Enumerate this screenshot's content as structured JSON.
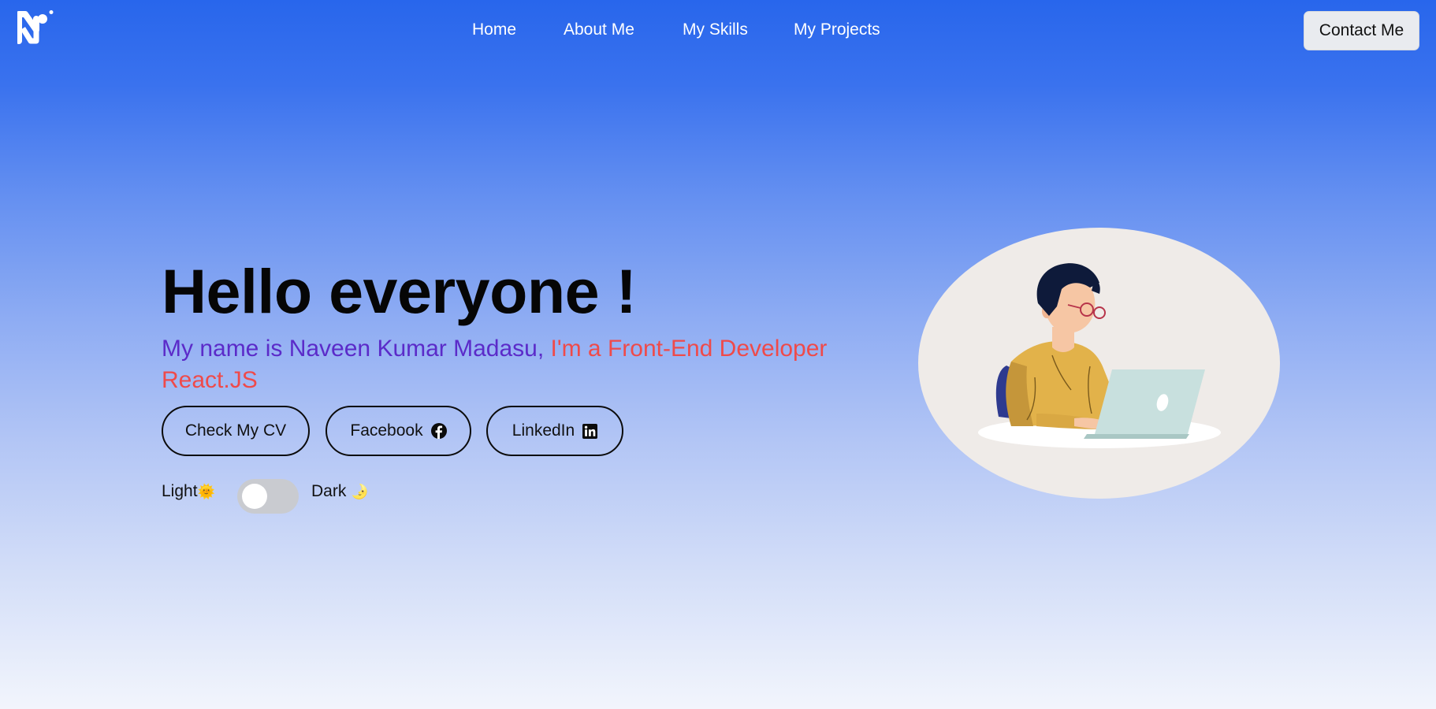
{
  "nav": {
    "links": [
      {
        "label": "Home"
      },
      {
        "label": "About Me"
      },
      {
        "label": "My Skills"
      },
      {
        "label": "My Projects"
      }
    ],
    "contact_label": "Contact Me"
  },
  "hero": {
    "headline": "Hello everyone !",
    "intro": "My name is Naveen Kumar Madasu,",
    "role": "I'm a Front-End Developer React.JS",
    "buttons": {
      "cv": "Check My CV",
      "facebook": "Facebook",
      "linkedin": "LinkedIn"
    }
  },
  "theme": {
    "light_label": "Light",
    "dark_label": "Dark",
    "light_emoji": "🌞",
    "dark_emoji": "🌛",
    "mode": "light"
  },
  "icons": {
    "logo": "n-logo-icon",
    "facebook": "facebook-icon",
    "linkedin": "linkedin-icon"
  },
  "colors": {
    "accent_purple": "#5b2bc9",
    "accent_red": "#ef4a4a",
    "gradient_top": "#2866ec",
    "gradient_bottom": "#f2f5fc",
    "contact_bg": "#e9ebef"
  }
}
